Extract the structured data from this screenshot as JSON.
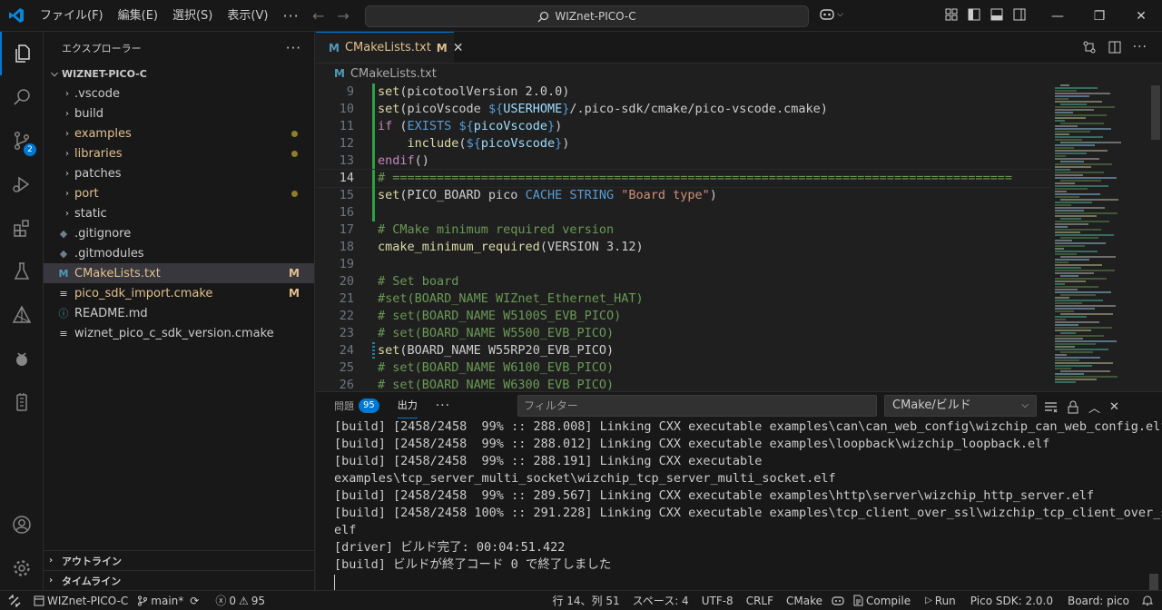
{
  "titlebar": {
    "menu": [
      "ファイル(F)",
      "編集(E)",
      "選択(S)",
      "表示(V)"
    ],
    "search_text": "WIZnet-PICO-C"
  },
  "activity": {
    "scm_badge": "2"
  },
  "sidebar": {
    "title": "エクスプローラー",
    "root": "WIZNET-PICO-C",
    "items": [
      {
        "label": ".vscode",
        "type": "folder",
        "color": "#cccccc"
      },
      {
        "label": "build",
        "type": "folder",
        "color": "#cccccc"
      },
      {
        "label": "examples",
        "type": "folder",
        "color": "#e2c08d",
        "dot": true
      },
      {
        "label": "libraries",
        "type": "folder",
        "color": "#e2c08d",
        "dot": true
      },
      {
        "label": "patches",
        "type": "folder",
        "color": "#cccccc"
      },
      {
        "label": "port",
        "type": "folder",
        "color": "#e2c08d",
        "dot": true
      },
      {
        "label": "static",
        "type": "folder",
        "color": "#cccccc"
      },
      {
        "label": ".gitignore",
        "type": "file",
        "icon": "git",
        "color": "#cccccc"
      },
      {
        "label": ".gitmodules",
        "type": "file",
        "icon": "git",
        "color": "#cccccc"
      },
      {
        "label": "CMakeLists.txt",
        "type": "file",
        "icon": "cmake",
        "color": "#e2c08d",
        "mark": "M",
        "selected": true
      },
      {
        "label": "pico_sdk_import.cmake",
        "type": "file",
        "icon": "lines",
        "color": "#e2c08d",
        "mark": "M"
      },
      {
        "label": "README.md",
        "type": "file",
        "icon": "info",
        "color": "#cccccc"
      },
      {
        "label": "wiznet_pico_c_sdk_version.cmake",
        "type": "file",
        "icon": "lines",
        "color": "#cccccc"
      }
    ],
    "outline": "アウトライン",
    "timeline": "タイムライン"
  },
  "editor": {
    "tab_label": "CMakeLists.txt",
    "tab_mark": "M",
    "breadcrumb": "CMakeLists.txt",
    "current_line": 14,
    "lines": [
      {
        "n": "9",
        "g": "mod",
        "t": [
          [
            "fn",
            "set"
          ],
          [
            "pn",
            "(picotoolVersion 2.0.0)"
          ]
        ]
      },
      {
        "n": "10",
        "g": "mod",
        "t": [
          [
            "fn",
            "set"
          ],
          [
            "pn",
            "(picoVscode "
          ],
          [
            "cb",
            "${"
          ],
          [
            "cv",
            "USERHOME"
          ],
          [
            "cb",
            "}"
          ],
          [
            "pn",
            "/.pico-sdk/cmake/pico-vscode.cmake)"
          ]
        ]
      },
      {
        "n": "11",
        "g": "mod",
        "t": [
          [
            "ck",
            "if"
          ],
          [
            "pn",
            " ("
          ],
          [
            "cb",
            "EXISTS "
          ],
          [
            "cb",
            "${"
          ],
          [
            "cv",
            "picoVscode"
          ],
          [
            "cb",
            "}"
          ],
          [
            "pn",
            ")"
          ]
        ]
      },
      {
        "n": "12",
        "g": "mod",
        "t": [
          [
            "pn",
            "    "
          ],
          [
            "fn",
            "include"
          ],
          [
            "pn",
            "("
          ],
          [
            "cb",
            "${"
          ],
          [
            "cv",
            "picoVscode"
          ],
          [
            "cb",
            "}"
          ],
          [
            "pn",
            ")"
          ]
        ]
      },
      {
        "n": "13",
        "g": "mod",
        "t": [
          [
            "ck",
            "endif"
          ],
          [
            "pn",
            "()"
          ]
        ]
      },
      {
        "n": "14",
        "g": "mod",
        "t": [
          [
            "cc",
            "# ===================================================================================="
          ]
        ]
      },
      {
        "n": "15",
        "g": "mod",
        "t": [
          [
            "fn",
            "set"
          ],
          [
            "pn",
            "(PICO_BOARD pico "
          ],
          [
            "cb",
            "CACHE STRING "
          ],
          [
            "cs",
            "\"Board type\""
          ],
          [
            "pn",
            ")"
          ]
        ]
      },
      {
        "n": "16",
        "g": "mod",
        "t": []
      },
      {
        "n": "17",
        "g": "",
        "t": [
          [
            "cc",
            "# CMake minimum required version"
          ]
        ]
      },
      {
        "n": "18",
        "g": "",
        "t": [
          [
            "fn",
            "cmake_minimum_required"
          ],
          [
            "pn",
            "(VERSION 3.12)"
          ]
        ]
      },
      {
        "n": "19",
        "g": "",
        "t": []
      },
      {
        "n": "20",
        "g": "",
        "t": [
          [
            "cc",
            "# Set board"
          ]
        ]
      },
      {
        "n": "21",
        "g": "",
        "t": [
          [
            "cc",
            "#set(BOARD_NAME WIZnet_Ethernet_HAT)"
          ]
        ]
      },
      {
        "n": "22",
        "g": "",
        "t": [
          [
            "cc",
            "# set(BOARD_NAME W5100S_EVB_PICO)"
          ]
        ]
      },
      {
        "n": "23",
        "g": "",
        "t": [
          [
            "cc",
            "# set(BOARD_NAME W5500_EVB_PICO)"
          ]
        ]
      },
      {
        "n": "24",
        "g": "chg",
        "t": [
          [
            "fn",
            "set"
          ],
          [
            "pn",
            "(BOARD_NAME W55RP20_EVB_PICO)"
          ]
        ]
      },
      {
        "n": "25",
        "g": "",
        "t": [
          [
            "cc",
            "# set(BOARD_NAME W6100_EVB_PICO)"
          ]
        ]
      },
      {
        "n": "26",
        "g": "",
        "t": [
          [
            "cc",
            "# set(BOARD_NAME W6300_EVB_PICO)"
          ]
        ]
      }
    ]
  },
  "panel": {
    "problems_label": "問題",
    "problems_count": "95",
    "output_label": "出力",
    "filter_placeholder": "フィルター",
    "channel": "CMake/ビルド",
    "output_lines": [
      "[build] [2458/2458  99% :: 288.008] Linking CXX executable examples\\can\\can_web_config\\wizchip_can_web_config.elf",
      "[build] [2458/2458  99% :: 288.012] Linking CXX executable examples\\loopback\\wizchip_loopback.elf",
      "[build] [2458/2458  99% :: 288.191] Linking CXX executable",
      "examples\\tcp_server_multi_socket\\wizchip_tcp_server_multi_socket.elf",
      "[build] [2458/2458  99% :: 289.567] Linking CXX executable examples\\http\\server\\wizchip_http_server.elf",
      "[build] [2458/2458 100% :: 291.228] Linking CXX executable examples\\tcp_client_over_ssl\\wizchip_tcp_client_over_ssl.",
      "elf",
      "[driver] ビルド完了: 00:04:51.422",
      "[build] ビルドが終了コード 0 で終了しました"
    ]
  },
  "statusbar": {
    "workspace": "WIZnet-PICO-C",
    "branch": "main*",
    "errors": "0",
    "warnings": "95",
    "position": "行 14、列 51",
    "spaces": "スペース: 4",
    "encoding": "UTF-8",
    "eol": "CRLF",
    "language": "CMake",
    "compile": "Compile",
    "run": "Run",
    "sdk": "Pico SDK: 2.0.0",
    "board": "Board: pico"
  }
}
